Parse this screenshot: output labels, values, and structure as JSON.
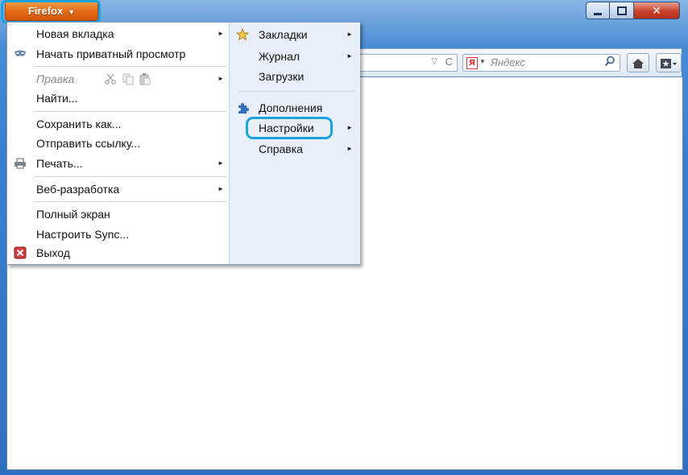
{
  "firefox_button": {
    "label": "Firefox",
    "arrow": "▼"
  },
  "window_controls": {
    "minimize": "▬",
    "maximize": "▢",
    "close": "✕"
  },
  "toolbar": {
    "search_placeholder": "Яндекс",
    "search_engine_logo": "Я",
    "url_dropdown": "▽",
    "reload": "C",
    "search_go": "⚲",
    "home": "⌂",
    "bookmarks": "★▾"
  },
  "menu": {
    "left": [
      {
        "label": "Новая вкладка",
        "arrow": "►"
      },
      {
        "label": "Начать приватный просмотр"
      },
      {
        "label": "Правка",
        "arrow": "►",
        "disabled": true
      },
      {
        "label": "Найти..."
      },
      {
        "label": "Сохранить как..."
      },
      {
        "label": "Отправить ссылку..."
      },
      {
        "label": "Печать...",
        "arrow": "►"
      },
      {
        "label": "Веб-разработка",
        "arrow": "►"
      },
      {
        "label": "Полный экран"
      },
      {
        "label": "Настроить Sync..."
      },
      {
        "label": "Выход"
      }
    ],
    "right": [
      {
        "label": "Закладки",
        "arrow": "►"
      },
      {
        "label": "Журнал",
        "arrow": "►"
      },
      {
        "label": "Загрузки"
      },
      {
        "label": "Дополнения"
      },
      {
        "label": "Настройки",
        "arrow": "►"
      },
      {
        "label": "Справка",
        "arrow": "►"
      }
    ]
  },
  "colors": {
    "highlight": "#1aa1e0",
    "firefox_orange": "#e46c18"
  }
}
